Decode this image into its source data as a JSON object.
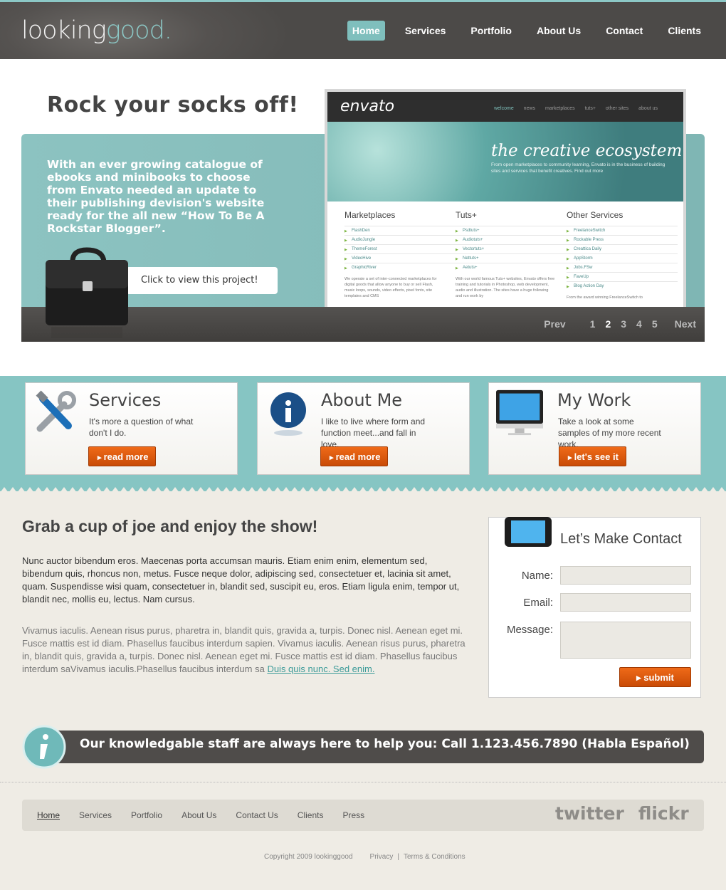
{
  "header": {
    "logo_part1": "looking",
    "logo_part2": "good",
    "logo_dot": ".",
    "nav": [
      "Home",
      "Services",
      "Portfolio",
      "About Us",
      "Contact",
      "Clients"
    ]
  },
  "hero": {
    "title": "Rock your socks off!",
    "text": "With an ever growing catalogue of ebooks and minibooks to choose from Envato needed an update to their publishing devision's website ready for the all new “How To Be A Rockstar Blogger”.",
    "cta": "Click to view this project!",
    "pager": {
      "prev": "Prev",
      "pages": [
        "1",
        "2",
        "3",
        "4",
        "5"
      ],
      "next": "Next"
    }
  },
  "envato": {
    "logo": "envato",
    "nav": [
      "welcome",
      "news",
      "marketplaces",
      "tuts+",
      "other sites",
      "about us"
    ],
    "tagline": "the creative ecosystem",
    "sub": "From open marketplaces to community learning, Envato is in the business of building sites and services that benefit creatives. Find out more",
    "columns": [
      {
        "title": "Marketplaces",
        "items": [
          "FlashDen",
          "AudioJungle",
          "ThemeForest",
          "VideoHive",
          "GraphicRiver"
        ],
        "blurb": "We operate a set of inter-connected marketplaces for digital goods that allow anyone to buy or sell Flash, music loops, sounds, video effects, pixel fonts, site templates and CMS"
      },
      {
        "title": "Tuts+",
        "items": [
          "Psdtuts+",
          "Audiotuts+",
          "Vectortuts+",
          "Nettuts+",
          "Aetuts+"
        ],
        "blurb": "With our world famous Tuts+ websites, Envato offers free training and tutorials in Photoshop, web development, audio and illustration. The sites have a huge following and run work by"
      },
      {
        "title": "Other Services",
        "items": [
          "FreelanceSwitch",
          "Rockable Press",
          "Creattica Daily",
          "AppStorm",
          "Jobs.FSw",
          "FaveUp",
          "Blog Action Day"
        ],
        "blurb": "From the award winning FreelanceSwitch to"
      }
    ]
  },
  "features": [
    {
      "title": "Services",
      "text": "It's more a question of what don't I do.",
      "button": "read more",
      "icon": "tools-icon"
    },
    {
      "title": "About Me",
      "text": "I like to live where form and function meet...and fall in love.",
      "button": "read more",
      "icon": "info-icon"
    },
    {
      "title": "My Work",
      "text": "Take a look at some samples of my more recent work.",
      "button": "let's see it",
      "icon": "monitor-icon"
    }
  ],
  "content": {
    "title": "Grab a cup of joe and enjoy the show!",
    "para1": "Nunc auctor bibendum eros. Maecenas porta accumsan mauris. Etiam enim enim, elementum sed, bibendum quis, rhoncus non, metus. Fusce neque dolor, adipiscing sed, consectetuer et, lacinia sit amet, quam. Suspendisse wisi quam, consectetuer in, blandit sed, suscipit eu, eros. Etiam ligula enim, tempor ut, blandit nec, mollis eu, lectus. Nam cursus.",
    "para2": "Vivamus iaculis. Aenean risus purus, pharetra in, blandit quis, gravida a, turpis. Donec nisl. Aenean eget mi. Fusce mattis est id diam. Phasellus faucibus interdum sapien. Vivamus iaculis. Aenean risus purus, pharetra in, blandit quis, gravida a, turpis. Donec nisl. Aenean eget mi. Fusce mattis est id diam. Phasellus faucibus interdum saVivamus iaculis.Phasellus faucibus interdum sa ",
    "link": "Duis quis nunc. Sed enim."
  },
  "contact": {
    "title": "Let’s Make Contact",
    "name_label": "Name:",
    "email_label": "Email:",
    "message_label": "Message:",
    "submit": "submit"
  },
  "callbar": {
    "text": "Our knowledgable staff are always here to help you:  Call 1.123.456.7890  (Habla Español)"
  },
  "footer": {
    "nav": [
      "Home",
      "Services",
      "Portfolio",
      "About Us",
      "Contact Us",
      "Clients",
      "Press"
    ],
    "social": [
      "twitter",
      "flickr"
    ],
    "copyright": "Copyright 2009 lookinggood",
    "privacy": "Privacy",
    "separator": "|",
    "terms": "Terms & Conditions"
  },
  "colors": {
    "accent": "#8cc8c6",
    "dark": "#4f4c4a",
    "orange": "#e05d10",
    "background": "#efece5"
  }
}
